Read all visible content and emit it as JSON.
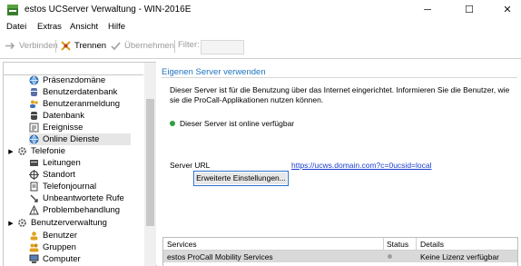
{
  "window": {
    "title": "estos UCServer Verwaltung - WIN-2016E",
    "controls": {
      "minimize": "─",
      "maximize": "☐",
      "close": "✕"
    }
  },
  "menu": {
    "items": [
      "Datei",
      "Extras",
      "Ansicht",
      "Hilfe"
    ]
  },
  "toolbar": {
    "connect": "Verbinden",
    "disconnect": "Trennen",
    "apply": "Übernehmen",
    "filter_label": "Filter:",
    "filter_value": ""
  },
  "tree": {
    "items": [
      {
        "label": "Präsenzdomäne",
        "icon": "globe-icon"
      },
      {
        "label": "Benutzerdatenbank",
        "icon": "database-icon"
      },
      {
        "label": "Benutzeranmeldung",
        "icon": "users-icon"
      },
      {
        "label": "Datenbank",
        "icon": "database-icon"
      },
      {
        "label": "Ereignisse",
        "icon": "events-icon"
      },
      {
        "label": "Online Dienste",
        "icon": "globe-icon",
        "selected": true
      },
      {
        "label": "Telefonie",
        "icon": "gear-icon",
        "group": true
      },
      {
        "label": "Leitungen",
        "icon": "lines-icon"
      },
      {
        "label": "Standort",
        "icon": "location-icon"
      },
      {
        "label": "Telefonjournal",
        "icon": "journal-icon"
      },
      {
        "label": "Unbeantwortete Rufe",
        "icon": "missed-call-icon"
      },
      {
        "label": "Problembehandlung",
        "icon": "warning-icon"
      },
      {
        "label": "Benutzerverwaltung",
        "icon": "gear-icon",
        "group": true
      },
      {
        "label": "Benutzer",
        "icon": "user-icon"
      },
      {
        "label": "Gruppen",
        "icon": "group-icon"
      },
      {
        "label": "Computer",
        "icon": "computer-icon"
      }
    ]
  },
  "content": {
    "section_title": "Eigenen Server verwenden",
    "description": "Dieser Server ist für die Benutzung über das Internet eingerichtet. Informieren Sie die Benutzer, wie sie die ProCall-Applikationen nutzen können.",
    "status_text": "Dieser Server ist online verfügbar",
    "status_color": "#2ea043",
    "server_url_label": "Server URL",
    "server_url": "https://ucws.domain.com?c=0ucsid=local",
    "advanced_button": "Erweiterte Einstellungen..."
  },
  "services_table": {
    "columns": [
      "Services",
      "Status",
      "Details"
    ],
    "rows": [
      {
        "service": "estos ProCall Mobility Services",
        "status": "",
        "details": "Keine Lizenz verfügbar"
      }
    ]
  }
}
